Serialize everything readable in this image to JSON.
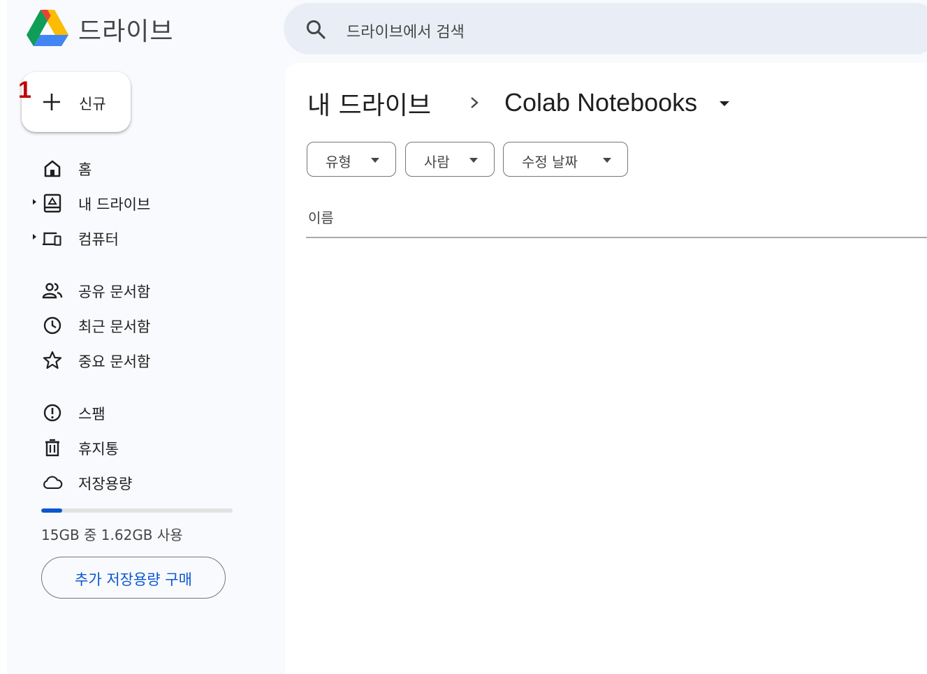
{
  "app": {
    "title": "드라이브"
  },
  "search": {
    "placeholder": "드라이브에서 검색"
  },
  "new_button": {
    "step_marker": "1",
    "label": "신규"
  },
  "sidebar": {
    "items": [
      {
        "id": "home",
        "label": "홈",
        "icon": "home-icon",
        "expandable": false
      },
      {
        "id": "my-drive",
        "label": "내 드라이브",
        "icon": "my-drive-icon",
        "expandable": true
      },
      {
        "id": "computers",
        "label": "컴퓨터",
        "icon": "computer-icon",
        "expandable": true
      },
      {
        "id": "shared",
        "label": "공유 문서함",
        "icon": "people-icon",
        "expandable": false
      },
      {
        "id": "recent",
        "label": "최근 문서함",
        "icon": "clock-icon",
        "expandable": false
      },
      {
        "id": "starred",
        "label": "중요 문서함",
        "icon": "star-icon",
        "expandable": false
      },
      {
        "id": "spam",
        "label": "스팸",
        "icon": "spam-icon",
        "expandable": false
      },
      {
        "id": "trash",
        "label": "휴지통",
        "icon": "trash-icon",
        "expandable": false
      },
      {
        "id": "storage",
        "label": "저장용량",
        "icon": "cloud-icon",
        "expandable": false
      }
    ],
    "storage": {
      "used_fraction": 0.108,
      "text": "15GB 중 1.62GB 사용",
      "buy_label": "추가 저장용량 구매"
    }
  },
  "main": {
    "breadcrumb": {
      "root": "내 드라이브",
      "current": "Colab Notebooks"
    },
    "filters": [
      {
        "label": "유형"
      },
      {
        "label": "사람"
      },
      {
        "label": "수정 날짜"
      }
    ],
    "columns": {
      "name": "이름"
    }
  },
  "colors": {
    "accent": "#0b57d0",
    "search_bg": "#e9eef6",
    "sidebar_bg": "#f8fafd",
    "step_marker": "#c00000"
  }
}
